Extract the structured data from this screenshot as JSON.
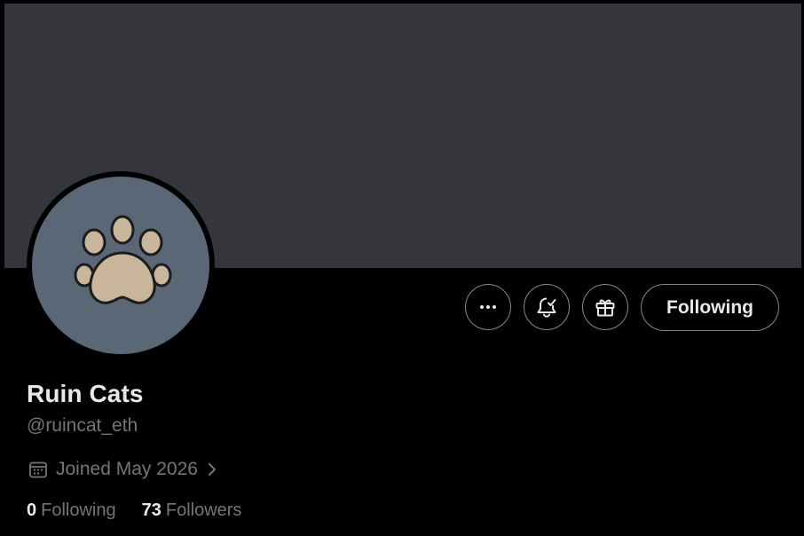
{
  "profile": {
    "name": "Ruin Cats",
    "handle": "@ruincat_eth",
    "joined": "Joined May 2026",
    "following_count": "0",
    "following_label": "Following",
    "followers_count": "73",
    "followers_label": "Followers"
  },
  "actions": {
    "more_icon": "more-horizontal-icon",
    "notify_icon": "bell-check-icon",
    "gift_icon": "gift-icon",
    "follow_label": "Following"
  },
  "colors": {
    "background": "#000000",
    "banner": "#35363b",
    "avatar_bg": "#5a6777",
    "paw": "#c9b59a",
    "primary_text": "#e7e9ea",
    "secondary_text": "#71767b",
    "button_border": "#828890"
  }
}
